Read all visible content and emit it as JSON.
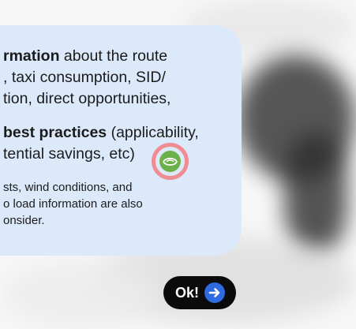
{
  "tooltip": {
    "line1_bold": "rmation",
    "line1_rest": " about the route",
    "line2": ", taxi consumption, SID/",
    "line3": "tion, direct opportunities,",
    "line4_bold": "best practices",
    "line4_rest": " (applicability,",
    "line5": "tential savings, etc)",
    "note_line1": "sts, wind conditions, and",
    "note_line2": "o load information are also",
    "note_line3": "onsider."
  },
  "hotspot": {
    "icon": "leaf-eye-icon",
    "ring_color": "#f08c94",
    "icon_color": "#6cb04a"
  },
  "ok_button": {
    "label": "Ok!",
    "icon": "arrow-right-icon",
    "accent": "#2f6be0"
  },
  "colors": {
    "card_background": "#dce9fb",
    "button_background": "#0b0b0b"
  }
}
